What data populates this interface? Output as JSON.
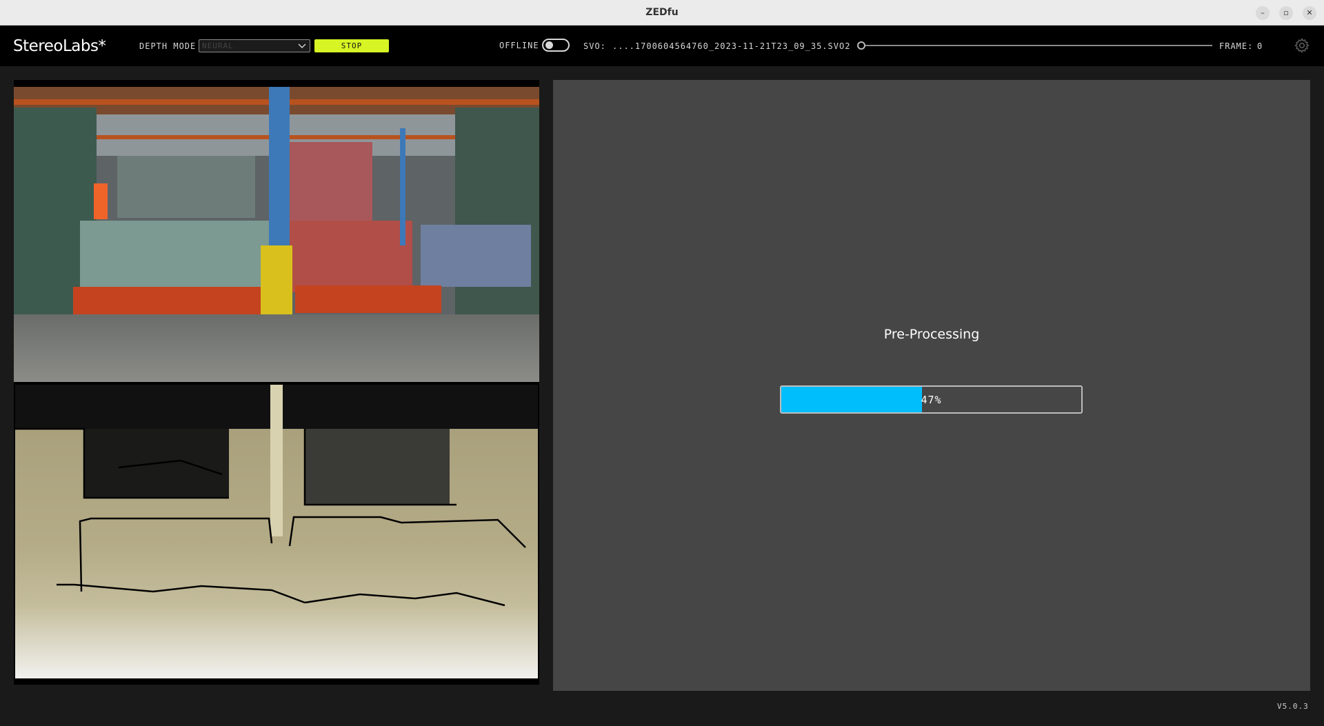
{
  "window": {
    "title": "ZEDfu",
    "minimize_label": "–",
    "maximize_label": "▫",
    "close_label": "✕"
  },
  "toolbar": {
    "logo": "StereoLabs*",
    "depth_mode_label": "DEPTH MODE",
    "depth_mode_value": "NEURAL",
    "stop_label": "STOP",
    "offline_label": "OFFLINE",
    "offline_enabled": false,
    "svo_label": "SVO:",
    "svo_value": "....1700604564760_2023-11-21T23_09_35.SVO2",
    "svo_position": 0,
    "frame_label": "FRAME:",
    "frame_value": "0",
    "settings_icon": "gear-icon"
  },
  "views": {
    "rgb_view": "camera-image",
    "depth_view": "depth-map"
  },
  "processing": {
    "title": "Pre-Processing",
    "percent": 47,
    "percent_label": "47%",
    "bar_color": "#00bdfc"
  },
  "footer": {
    "version": "V5.0.3"
  },
  "colors": {
    "accent": "#d7f424",
    "progress": "#00bdfc",
    "panel": "#464646",
    "background": "#1a1a1a"
  }
}
